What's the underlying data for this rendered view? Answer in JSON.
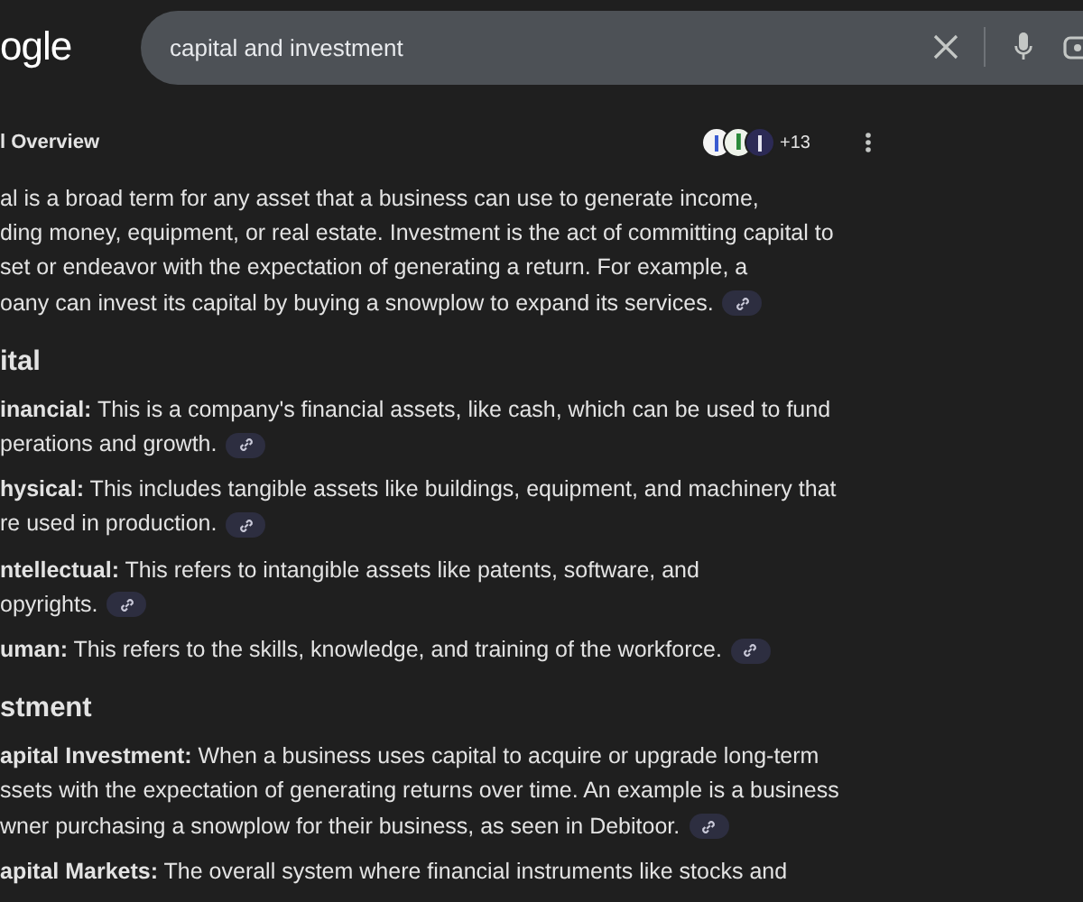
{
  "logo": "ogle",
  "search": {
    "value": "capital and investment"
  },
  "overview": {
    "title": "l Overview",
    "source_count": "+13"
  },
  "intro": {
    "lines": [
      "al is a broad term for any asset that a business can use to generate income,",
      "ding money, equipment, or real estate. Investment is the act of committing capital to",
      "set or endeavor with the expectation of generating a return. For example, a",
      "oany can invest its capital by buying a snowplow to expand its services."
    ],
    "link": true
  },
  "sections": [
    {
      "heading": "ital",
      "items": [
        {
          "lines": [
            "**inancial:** This is a company's financial assets, like cash, which can be used to fund",
            "perations and growth."
          ],
          "link": true
        },
        {
          "lines": [
            "**hysical:** This includes tangible assets like buildings, equipment, and machinery that",
            "re used in production."
          ],
          "link": true
        },
        {
          "lines": [
            "**ntellectual:** This refers to intangible assets like patents, software, and",
            "opyrights."
          ],
          "link": true
        },
        {
          "lines": [
            "**uman:** This refers to the skills, knowledge, and training of the workforce."
          ],
          "link": true
        }
      ]
    },
    {
      "heading": "stment",
      "items": [
        {
          "lines": [
            "**apital Investment:** When a business uses capital to acquire or upgrade long-term",
            "ssets with the expectation of generating returns over time. An example is a business",
            "wner purchasing a snowplow for their business, as seen in Debitoor."
          ],
          "link": true
        },
        {
          "lines": [
            "**apital Markets:** The overall system where financial instruments like stocks and"
          ],
          "link": false
        }
      ]
    }
  ]
}
